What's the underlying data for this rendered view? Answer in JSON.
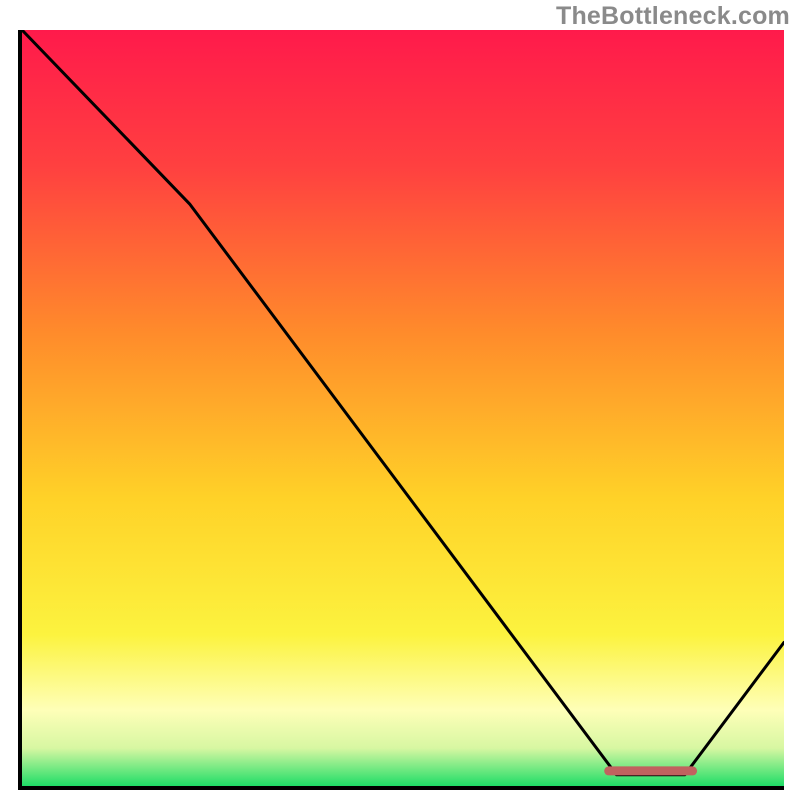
{
  "watermark": "TheBottleneck.com",
  "chart_data": {
    "type": "line",
    "title": "",
    "xlabel": "",
    "ylabel": "",
    "xlim": [
      0,
      100
    ],
    "ylim": [
      0,
      100
    ],
    "grid": false,
    "gradient_stops": [
      {
        "offset": 0,
        "color": "#ff1a4b"
      },
      {
        "offset": 18,
        "color": "#ff4040"
      },
      {
        "offset": 40,
        "color": "#ff8b2b"
      },
      {
        "offset": 62,
        "color": "#ffd228"
      },
      {
        "offset": 80,
        "color": "#fcf33f"
      },
      {
        "offset": 90,
        "color": "#feffb8"
      },
      {
        "offset": 95,
        "color": "#d7f7a2"
      },
      {
        "offset": 100,
        "color": "#1fdd67"
      }
    ],
    "curve_points": [
      {
        "x": 0,
        "y": 100
      },
      {
        "x": 22,
        "y": 77
      },
      {
        "x": 78,
        "y": 1.5
      },
      {
        "x": 87,
        "y": 1.5
      },
      {
        "x": 100,
        "y": 19
      }
    ],
    "marker": {
      "x_start": 77,
      "x_end": 88,
      "y": 2
    }
  }
}
